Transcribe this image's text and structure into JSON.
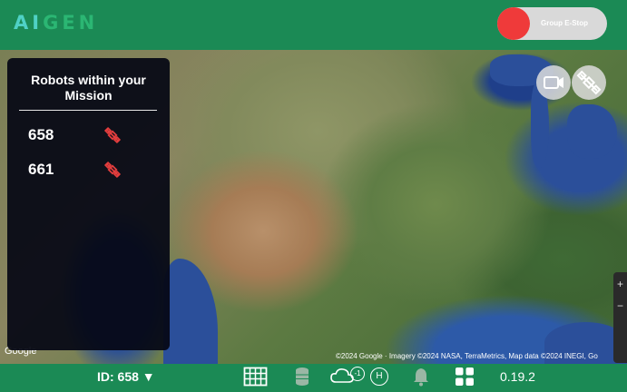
{
  "header": {
    "logo_text": "AIGEN",
    "estop_label": "Group E-Stop",
    "estop_color": "#ef3a3a"
  },
  "map": {
    "google_label": "Google",
    "attribution": "©2024 Google · Imagery ©2024 NASA, TerraMetrics, Map data ©2024 INEGI, Go",
    "zoom_in": "+",
    "zoom_out": "−"
  },
  "panel": {
    "title": "Robots within your Mission",
    "robots": [
      {
        "id": "658",
        "icon": "satellite-off-icon"
      },
      {
        "id": "661",
        "icon": "satellite-off-icon"
      }
    ]
  },
  "footer": {
    "robot_select": "ID: 658 ▼",
    "cloud_badge": "-1",
    "h_badge": "H",
    "version": "0.19.2"
  },
  "colors": {
    "brand_green": "#1b8a55",
    "alert_red": "#e53e3e"
  }
}
